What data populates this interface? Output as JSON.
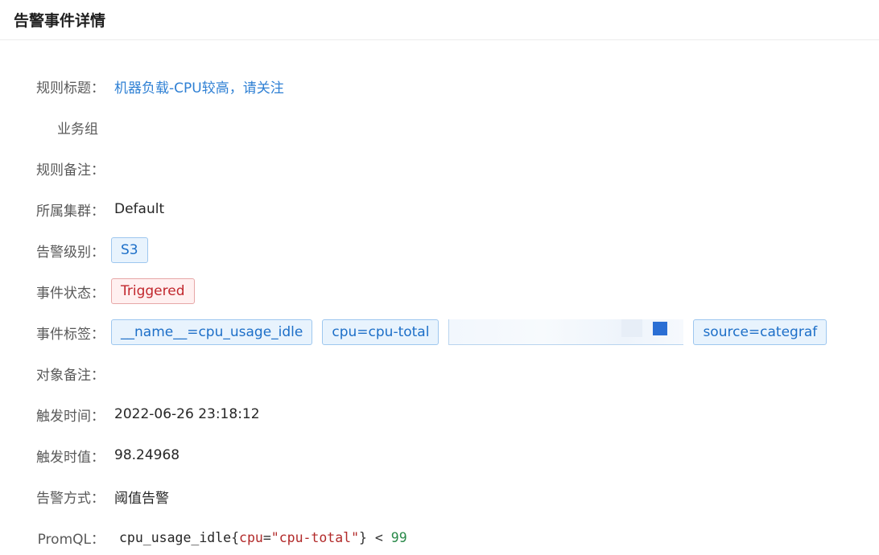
{
  "page": {
    "title": "告警事件详情"
  },
  "fields": {
    "rule_title": {
      "label": "规则标题：",
      "value": "机器负载-CPU较高，请关注"
    },
    "business_group": {
      "label": "业务组"
    },
    "rule_note": {
      "label": "规则备注：",
      "value": ""
    },
    "cluster": {
      "label": "所属集群：",
      "value": "Default"
    },
    "severity": {
      "label": "告警级别：",
      "value": "S3"
    },
    "status": {
      "label": "事件状态：",
      "value": "Triggered"
    },
    "tags": {
      "label": "事件标签：",
      "items": [
        "__name__=cpu_usage_idle",
        "cpu=cpu-total",
        "source=categraf"
      ]
    },
    "target_note": {
      "label": "对象备注：",
      "value": ""
    },
    "trigger_time": {
      "label": "触发时间：",
      "value": "2022-06-26 23:18:12"
    },
    "trigger_value": {
      "label": "触发时值：",
      "value": "98.24968"
    },
    "alert_method": {
      "label": "告警方式：",
      "value": "阈值告警"
    },
    "promql": {
      "label": "PromQL：",
      "metric": "cpu_usage_idle",
      "open_brace": "{",
      "key": "cpu",
      "eq": "=",
      "string": "\"cpu-total\"",
      "close_brace": "}",
      "operator": " < ",
      "threshold": "99"
    }
  },
  "colors": {
    "link": "#2f80d4",
    "tag_blue": "#1d6fc8",
    "tag_red": "#c1272d"
  }
}
